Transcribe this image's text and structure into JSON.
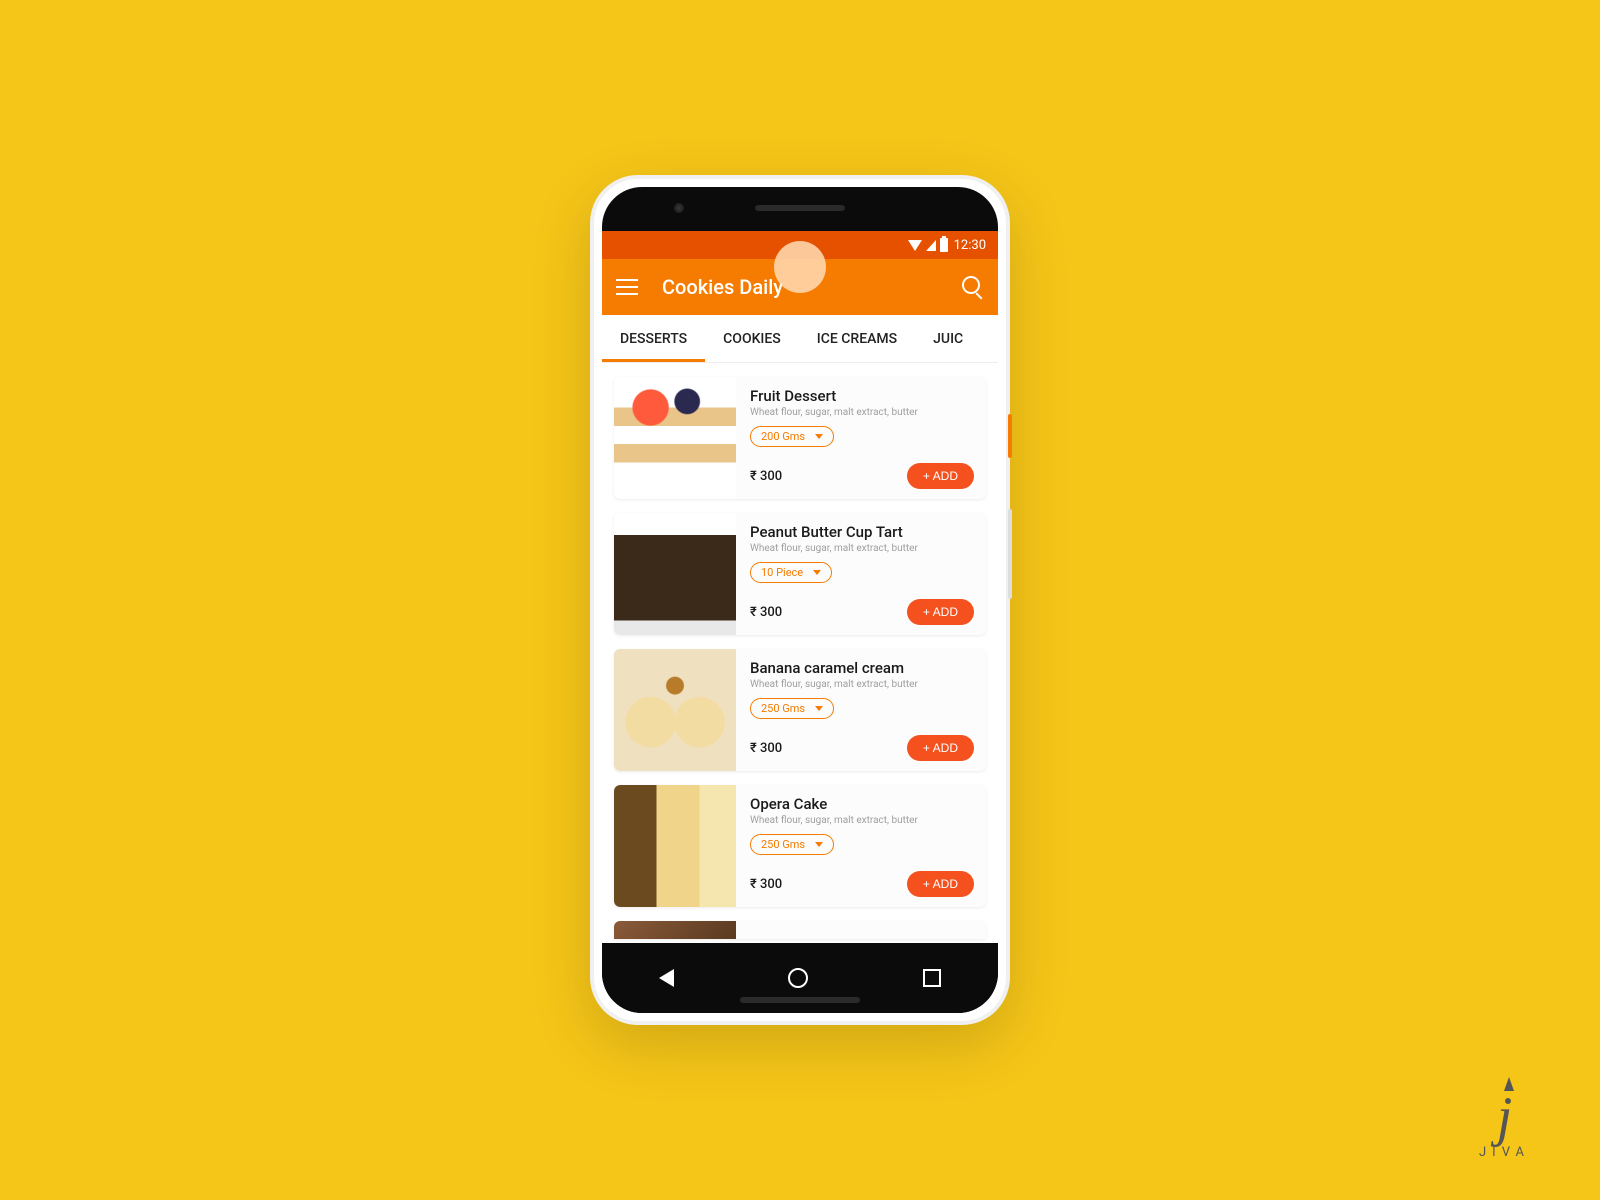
{
  "statusbar": {
    "time": "12:30"
  },
  "appbar": {
    "title": "Cookies Daily"
  },
  "tabs": [
    {
      "label": "DESSERTS",
      "active": true
    },
    {
      "label": "COOKIES",
      "active": false
    },
    {
      "label": "ICE CREAMS",
      "active": false
    },
    {
      "label": "JUIC",
      "active": false
    }
  ],
  "items": [
    {
      "name": "Fruit Dessert",
      "desc": "Wheat flour, sugar, malt extract, butter",
      "size": "200 Gms",
      "price": "₹ 300",
      "add": "+ ADD",
      "img": "img-fruit"
    },
    {
      "name": "Peanut Butter Cup Tart",
      "desc": "Wheat flour, sugar, malt extract, butter",
      "size": "10 Piece",
      "price": "₹ 300",
      "add": "+ ADD",
      "img": "img-peanut"
    },
    {
      "name": "Banana caramel cream",
      "desc": "Wheat flour, sugar, malt extract, butter",
      "size": "250 Gms",
      "price": "₹ 300",
      "add": "+ ADD",
      "img": "img-banana"
    },
    {
      "name": "Opera Cake",
      "desc": "Wheat flour, sugar, malt extract, butter",
      "size": "250 Gms",
      "price": "₹ 300",
      "add": "+ ADD",
      "img": "img-opera"
    }
  ],
  "logo": {
    "text": "JIVA"
  }
}
